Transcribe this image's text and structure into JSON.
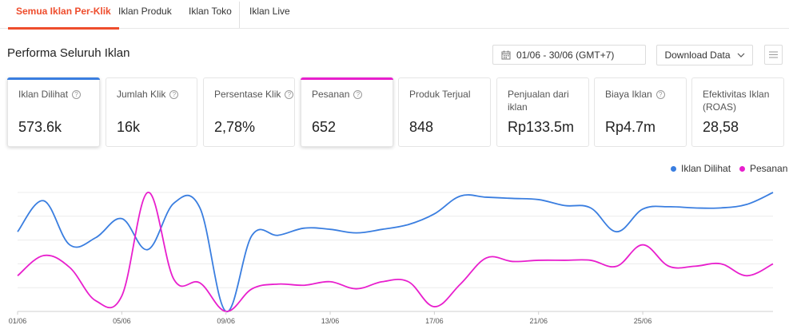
{
  "tabs": [
    {
      "label": "Semua Iklan Per-Klik",
      "active": true
    },
    {
      "label": "Iklan Produk",
      "active": false
    },
    {
      "label": "Iklan Toko",
      "active": false
    },
    {
      "label": "Iklan Live",
      "active": false
    }
  ],
  "section_title": "Performa Seluruh Iklan",
  "date_range": "01/06 - 30/06 (GMT+7)",
  "download_label": "Download Data",
  "icons": {
    "calendar": "calendar-icon",
    "dropdown": "chevron-down-icon",
    "menu": "menu-icon",
    "info": "info-icon"
  },
  "colors": {
    "accent": "#ee4d2d",
    "series_views": "#3a7ee0",
    "series_orders": "#e81fcd"
  },
  "metrics": [
    {
      "label": "Iklan Dilihat",
      "value": "573.6k",
      "selected": true,
      "bar_color": "#3a7ee0"
    },
    {
      "label": "Jumlah Klik",
      "value": "16k",
      "selected": false
    },
    {
      "label": "Persentase Klik",
      "value": "2,78%",
      "selected": false
    },
    {
      "label": "Pesanan",
      "value": "652",
      "selected": true,
      "bar_color": "#e81fcd"
    },
    {
      "label": "Produk Terjual",
      "value": "848",
      "selected": false
    },
    {
      "label": "Penjualan dari iklan",
      "value": "Rp133.5m",
      "selected": false
    },
    {
      "label": "Biaya Iklan",
      "value": "Rp4.7m",
      "selected": false
    },
    {
      "label": "Efektivitas Iklan (ROAS)",
      "value": "28,58",
      "selected": false
    }
  ],
  "chart_data": {
    "type": "line",
    "x": [
      "01/06",
      "02/06",
      "03/06",
      "04/06",
      "05/06",
      "06/06",
      "07/06",
      "08/06",
      "09/06",
      "10/06",
      "11/06",
      "12/06",
      "13/06",
      "14/06",
      "15/06",
      "16/06",
      "17/06",
      "18/06",
      "19/06",
      "20/06",
      "21/06",
      "22/06",
      "23/06",
      "24/06",
      "25/06",
      "26/06",
      "27/06",
      "28/06",
      "29/06",
      "30/06"
    ],
    "x_tick_labels": [
      "01/06",
      "05/06",
      "09/06",
      "13/06",
      "17/06",
      "21/06",
      "25/06"
    ],
    "series": [
      {
        "name": "Iklan Dilihat",
        "color": "#3a7ee0",
        "values": [
          0.67,
          0.93,
          0.56,
          0.62,
          0.78,
          0.52,
          0.91,
          0.87,
          0.0,
          0.64,
          0.64,
          0.7,
          0.69,
          0.66,
          0.69,
          0.73,
          0.82,
          0.97,
          0.96,
          0.95,
          0.94,
          0.89,
          0.87,
          0.67,
          0.86,
          0.88,
          0.87,
          0.87,
          0.9,
          1.0
        ]
      },
      {
        "name": "Pesanan",
        "color": "#e81fcd",
        "values": [
          0.3,
          0.47,
          0.37,
          0.09,
          0.13,
          1.0,
          0.27,
          0.24,
          0.0,
          0.19,
          0.23,
          0.22,
          0.25,
          0.19,
          0.25,
          0.25,
          0.04,
          0.23,
          0.45,
          0.42,
          0.43,
          0.43,
          0.43,
          0.38,
          0.56,
          0.38,
          0.38,
          0.4,
          0.3,
          0.4
        ]
      }
    ],
    "legend": [
      "Iklan Dilihat",
      "Pesanan"
    ],
    "legend_placement": "top-right",
    "ylim": [
      0,
      1
    ],
    "grid": true
  }
}
